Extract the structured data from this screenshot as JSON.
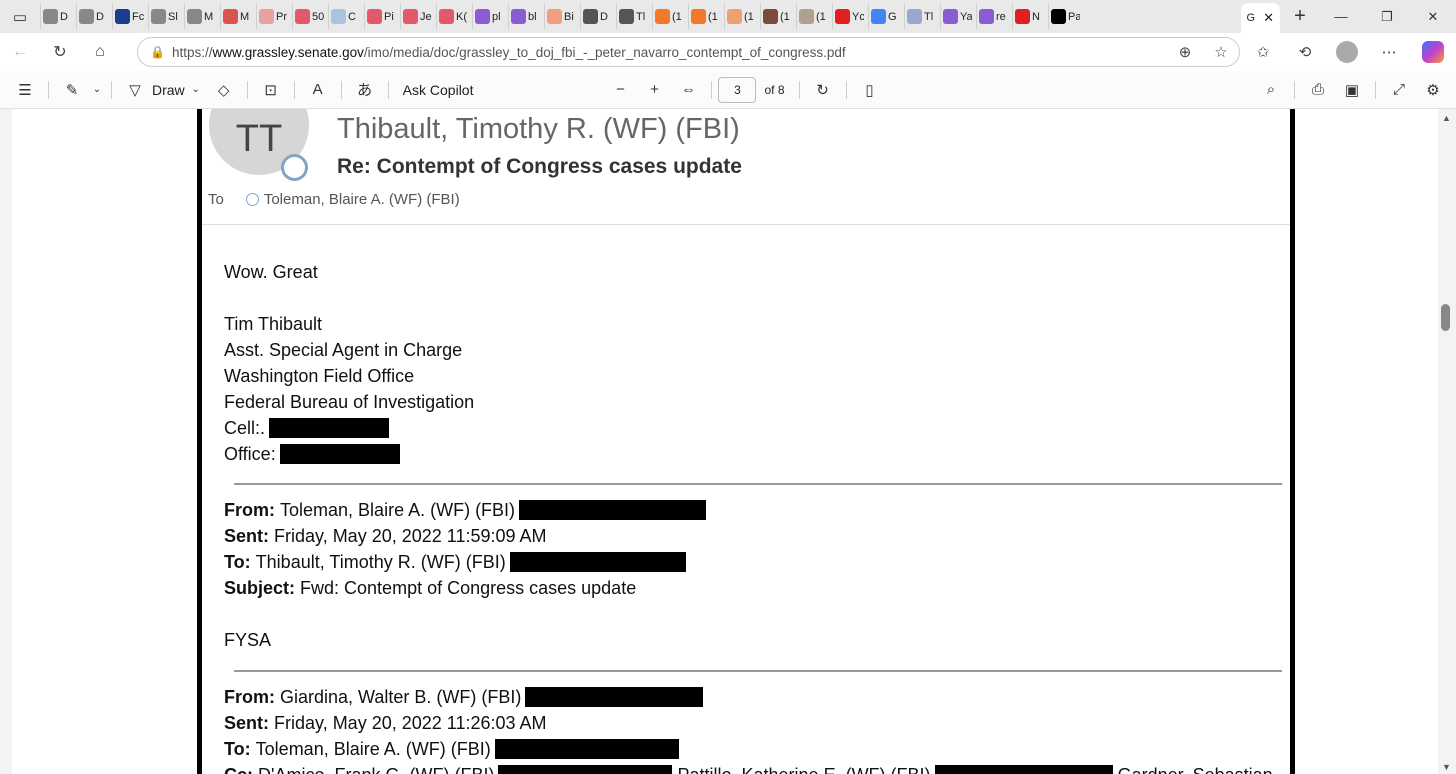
{
  "browser": {
    "tabs": [
      {
        "label": "D",
        "color": "#888888"
      },
      {
        "label": "D",
        "color": "#888888"
      },
      {
        "label": "Fc",
        "color": "#1a3d8f"
      },
      {
        "label": "Sl",
        "color": "#888888"
      },
      {
        "label": "M",
        "color": "#888888"
      },
      {
        "label": "M",
        "color": "#d9534f"
      },
      {
        "label": "Pr",
        "color": "#e8a0a0"
      },
      {
        "label": "50",
        "color": "#e05a6a"
      },
      {
        "label": "C",
        "color": "#a8c4e0"
      },
      {
        "label": "Pi",
        "color": "#e05a6a"
      },
      {
        "label": "Je",
        "color": "#e05a6a"
      },
      {
        "label": "K(",
        "color": "#e05a6a"
      },
      {
        "label": "pl",
        "color": "#8a5bd1"
      },
      {
        "label": "bl",
        "color": "#8a5bd1"
      },
      {
        "label": "Bi",
        "color": "#f0a080"
      },
      {
        "label": "D",
        "color": "#555555"
      },
      {
        "label": "Tl",
        "color": "#555555"
      },
      {
        "label": "(1",
        "color": "#f07a2a"
      },
      {
        "label": "(1",
        "color": "#f07a2a"
      },
      {
        "label": "(1",
        "color": "#f0a070"
      },
      {
        "label": "(1",
        "color": "#7a4a3a"
      },
      {
        "label": "(1",
        "color": "#b0a090"
      },
      {
        "label": "Yc",
        "color": "#e02020"
      },
      {
        "label": "G",
        "color": "#4285f4"
      },
      {
        "label": "Tl",
        "color": "#9aa8d0"
      },
      {
        "label": "Ya",
        "color": "#8a5bd1"
      },
      {
        "label": "re",
        "color": "#8a5bd1"
      },
      {
        "label": "N",
        "color": "#e02020"
      },
      {
        "label": "Pa",
        "color": "#000000"
      }
    ],
    "active_tab_label": "G",
    "url_prefix": "https://",
    "url_host": "www.grassley.senate.gov",
    "url_path": "/imo/media/doc/grassley_to_doj_fbi_-_peter_navarro_contempt_of_congress.pdf"
  },
  "pdf_toolbar": {
    "draw_label": "Draw",
    "ask_copilot_label": "Ask Copilot",
    "page_number": "3",
    "page_of": "of 8"
  },
  "email": {
    "avatar_initials": "TT",
    "sender": "Thibault, Timothy R. (WF) (FBI)",
    "subject": "Re: Contempt of Congress cases update",
    "to_label": "To",
    "to_value": "Toleman, Blaire A. (WF) (FBI)",
    "body_greeting": "Wow.  Great",
    "sig_name": "Tim Thibault",
    "sig_title": "Asst. Special Agent in Charge",
    "sig_office": "Washington Field Office",
    "sig_org": "Federal Bureau of Investigation",
    "sig_cell": "Cell:.",
    "sig_office_phone": "Office:",
    "fwd1": {
      "from_label": "From:",
      "from_value": "Toleman, Blaire A. (WF) (FBI)",
      "sent_label": "Sent:",
      "sent_value": "Friday, May 20, 2022 11:59:09 AM",
      "to_label": "To:",
      "to_value": "Thibault, Timothy R. (WF) (FBI)",
      "subject_label": "Subject:",
      "subject_value": "Fwd: Contempt of Congress cases update",
      "note": "FYSA"
    },
    "fwd2": {
      "from_label": "From:",
      "from_value": "Giardina, Walter B. (WF) (FBI)",
      "sent_label": "Sent:",
      "sent_value": "Friday, May 20, 2022 11:26:03 AM",
      "to_label": "To:",
      "to_value": "Toleman, Blaire A. (WF) (FBI)",
      "cc_label": "Cc:",
      "cc_value_1": "D'Amico, Frank G. (WF) (FBI)",
      "cc_value_2": "Pattillo, Katherine E. (WF) (FBI)",
      "cc_value_3": "Gardner, Sebastian"
    }
  }
}
